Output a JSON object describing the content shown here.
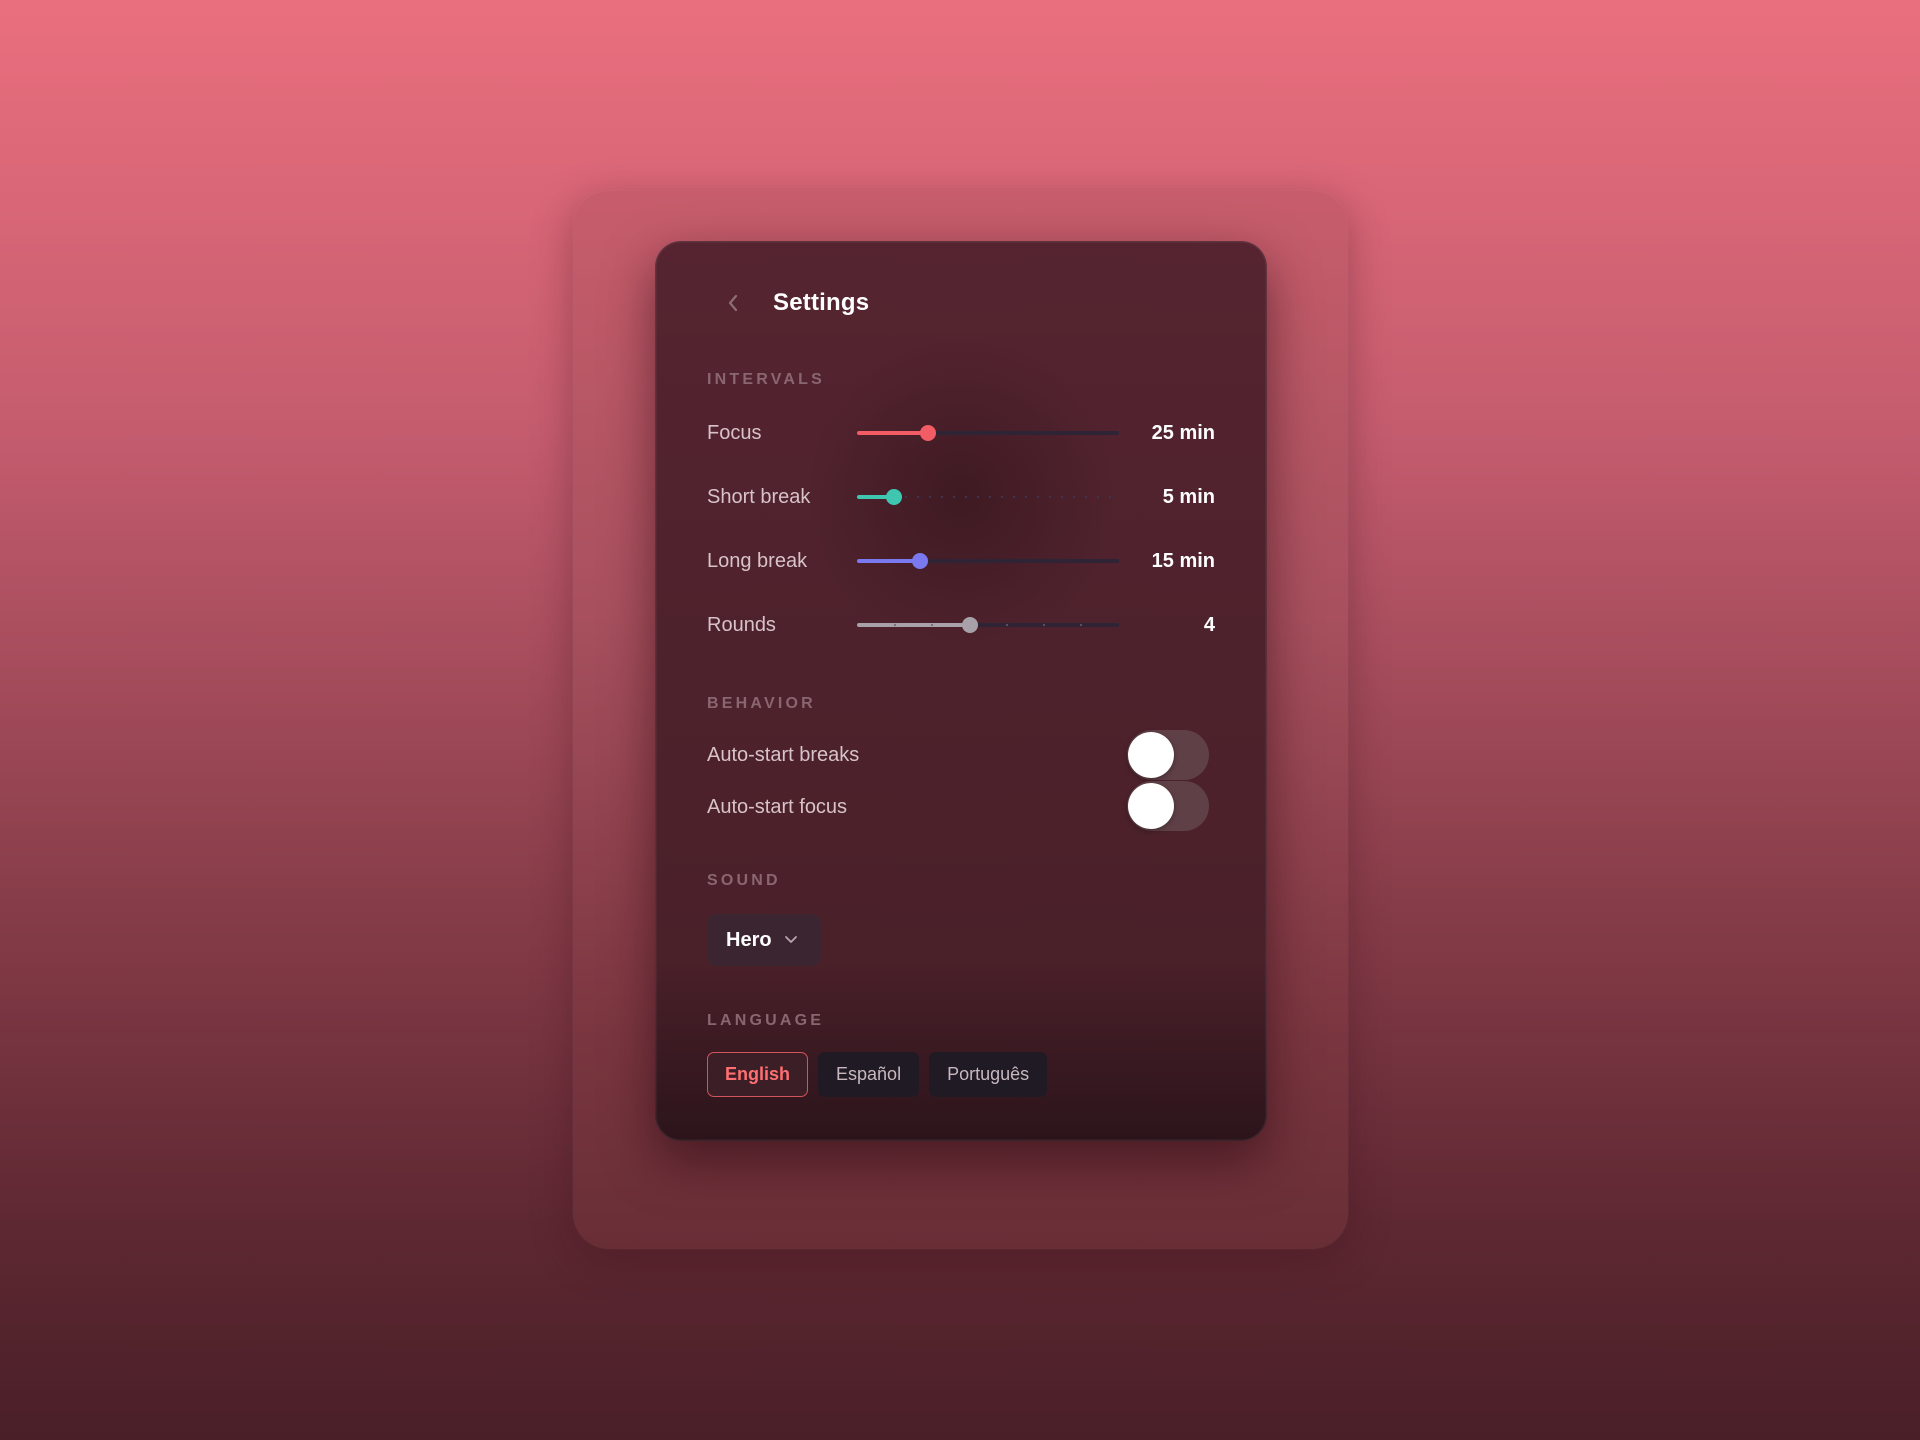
{
  "header": {
    "title": "Settings"
  },
  "sections": {
    "intervals": "INTERVALS",
    "behavior": "BEHAVIOR",
    "sound": "SOUND",
    "language": "LANGUAGE"
  },
  "intervals": [
    {
      "label": "Focus",
      "value": "25 min",
      "level": 0.27,
      "color": "#f25c64"
    },
    {
      "label": "Short break",
      "value": "5 min",
      "level": 0.14,
      "color": "#3fc6b0"
    },
    {
      "label": "Long break",
      "value": "15 min",
      "level": 0.24,
      "color": "#7b79f0"
    },
    {
      "label": "Rounds",
      "value": "4",
      "level": 0.43,
      "color": "#a8a1aa"
    }
  ],
  "behavior": [
    {
      "label": "Auto-start breaks",
      "on": false
    },
    {
      "label": "Auto-start focus",
      "on": false
    }
  ],
  "sound": {
    "selected": "Hero"
  },
  "language": {
    "options": [
      "English",
      "Español",
      "Português"
    ],
    "selected": "English"
  },
  "icons": {
    "back": "chevron-left-icon",
    "dropdown": "chevron-down-icon"
  }
}
